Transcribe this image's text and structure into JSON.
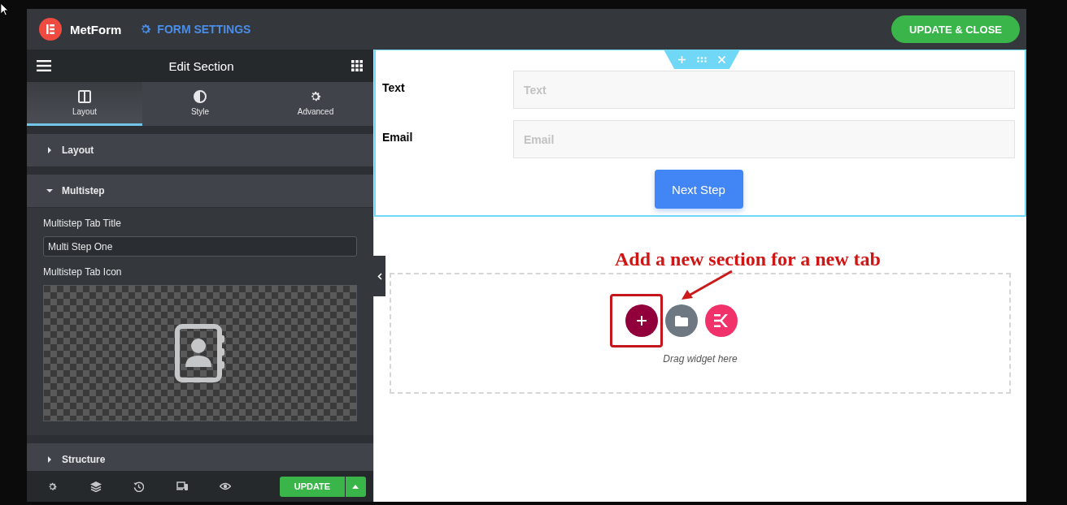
{
  "header": {
    "brand": "MetForm",
    "settings_link": "FORM SETTINGS",
    "update_close_button": "UPDATE & CLOSE"
  },
  "panel": {
    "title": "Edit Section",
    "tabs": [
      {
        "kind": "layout",
        "label": "Layout",
        "selected": true
      },
      {
        "kind": "style",
        "label": "Style",
        "selected": false
      },
      {
        "kind": "advanced",
        "label": "Advanced",
        "selected": false
      }
    ],
    "sections": [
      {
        "title": "Layout",
        "expanded": false
      },
      {
        "title": "Multistep",
        "expanded": true,
        "fields": [
          {
            "kind": "text",
            "label": "Multistep Tab Title",
            "value": "Multi Step One"
          },
          {
            "kind": "icon_picker",
            "label": "Multistep Tab Icon"
          }
        ]
      },
      {
        "title": "Structure",
        "expanded": false
      }
    ],
    "footer": {
      "update_button": "UPDATE"
    }
  },
  "canvas": {
    "form_fields": [
      {
        "label": "Text",
        "placeholder": "Text"
      },
      {
        "label": "Email",
        "placeholder": "Email"
      }
    ],
    "next_button": "Next Step",
    "dropzone_hint": "Drag widget here",
    "annotation": "Add a new section for a new tab"
  }
}
